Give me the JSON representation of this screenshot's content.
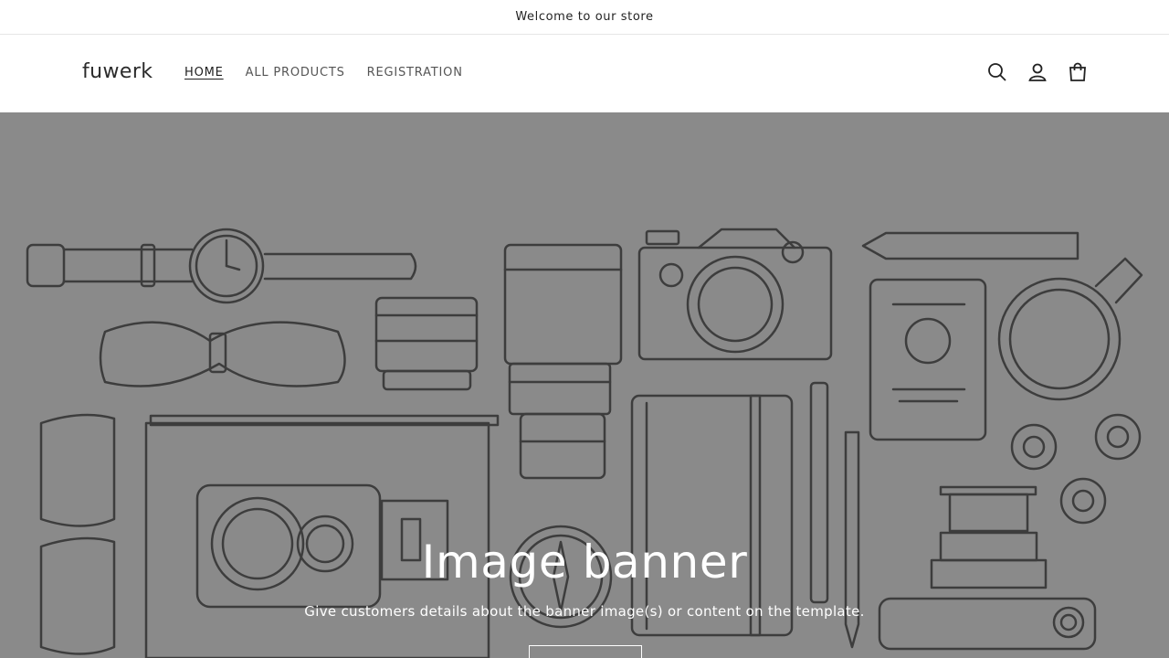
{
  "announcement": {
    "text": "Welcome to our store"
  },
  "header": {
    "logo": "fuwerk",
    "nav": [
      {
        "label": "HOME",
        "active": true
      },
      {
        "label": "ALL PRODUCTS",
        "active": false
      },
      {
        "label": "REGISTRATION",
        "active": false
      }
    ],
    "icons": [
      "search-icon",
      "account-icon",
      "cart-icon"
    ]
  },
  "banner": {
    "title": "Image banner",
    "subtitle": "Give customers details about the banner image(s) or content on the template.",
    "button_label": ""
  },
  "colors": {
    "banner_bg": "#8a8a8a",
    "line_art": "#3d3d3d",
    "text_light": "#ffffff"
  }
}
